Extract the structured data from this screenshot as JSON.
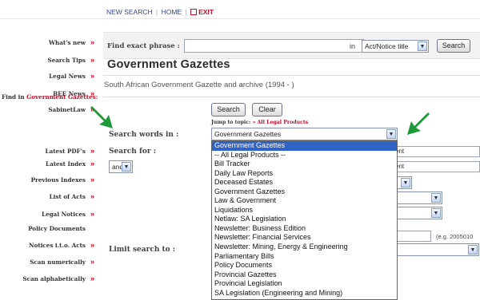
{
  "top_nav": {
    "new_search": "NEW SEARCH",
    "home": "HOME",
    "exit": "EXIT",
    "sep": "|"
  },
  "sidebar": {
    "items": [
      {
        "label": "What's new"
      },
      {
        "label": "Search Tips"
      },
      {
        "label": "Legal News"
      },
      {
        "label": "BEE News"
      },
      {
        "label": "SabinetLaw"
      }
    ],
    "find_in_prefix": "Find in",
    "find_in_section": "Government Gazettes:",
    "sub_items": [
      {
        "label": "Latest PDF's"
      },
      {
        "label": "Latest Index"
      },
      {
        "label": "Previous Indexes"
      },
      {
        "label": "List of Acts"
      },
      {
        "label": "Legal Notices"
      },
      {
        "label": "Policy Documents"
      },
      {
        "label": "Notices i.t.o. Acts"
      },
      {
        "label": "Scan numerically"
      },
      {
        "label": "Scan alphabetically"
      }
    ],
    "arrow": "»"
  },
  "phrase_search": {
    "label": "Find exact phrase :",
    "value": "",
    "in_label": "in",
    "field_value": "Act/Notice title",
    "search_button": "Search"
  },
  "page": {
    "title": "Government Gazettes",
    "subtitle": "South African Government Gazette and archive (1994 - )"
  },
  "form": {
    "search_button": "Search",
    "clear_button": "Clear",
    "jump_label": "Jump to topic:",
    "jump_arrow": "»",
    "jump_link": "All Legal Products",
    "search_words_label": "Search words in :",
    "search_for_label": "Search for :",
    "operator_value": "and",
    "limit_label": "Limit search to :",
    "selected_product": "Government Gazettes",
    "date_hint": "(e.g. 2005010",
    "behind_text_1": "ent",
    "behind_text_2": "ent"
  },
  "dropdown_options": [
    "Government Gazettes",
    "-- All Legal Products --",
    "Bill Tracker",
    "Daily Law Reports",
    "Deceased Estates",
    "Government Gazettes",
    "Law & Government",
    "Liquidations",
    "Netlaw: SA Legislation",
    "Newsletter: Business Edition",
    "Newsletter: Financial Services",
    "Newsletter: Mining, Energy & Engineering",
    "Parliamentary Bills",
    "Policy Documents",
    "Provincial Gazettes",
    "Provincial Legislation",
    "SA Legislation (Engineering and Mining)"
  ],
  "icons": {
    "exit": "exit-icon",
    "dropdown": "chevron-down-icon",
    "pointer": "green-arrow-icon"
  },
  "colors": {
    "accent_red": "#c0102a",
    "nav_blue": "#35488a",
    "selection_blue": "#3163c5",
    "annotation_green": "#1e9a3a"
  }
}
